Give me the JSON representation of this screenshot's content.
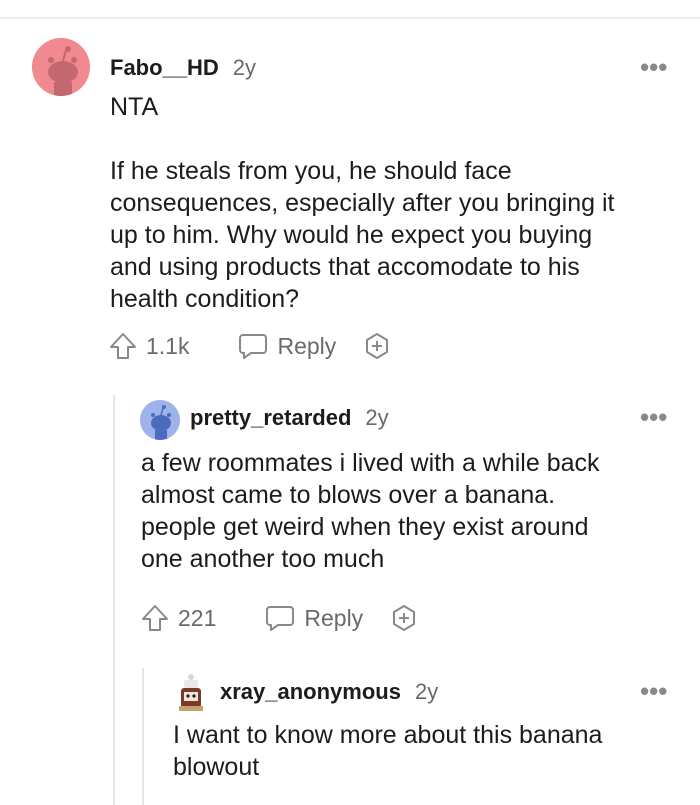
{
  "comments": [
    {
      "author": "Fabo__HD",
      "age": "2y",
      "more_label": "•••",
      "body": "NTA\n\nIf he steals from you, he should face\nconsequences, especially after you bringing it\nup to him. Why would he expect you buying\nand using products that accomodate to his\nhealth condition?",
      "upvotes": "1.1k",
      "reply_label": "Reply",
      "avatar_color": "#f08a90",
      "icons": [
        "upvote-icon",
        "reply-icon",
        "award-icon"
      ]
    },
    {
      "author": "pretty_retarded",
      "age": "2y",
      "more_label": "•••",
      "body": "a few roommates i lived with a while back\nalmost came to blows over a banana.\npeople get weird when they exist around\none another too much",
      "upvotes": "221",
      "reply_label": "Reply",
      "avatar_color": "#9db3ea",
      "icons": [
        "upvote-icon",
        "reply-icon",
        "award-icon"
      ]
    },
    {
      "author": "xray_anonymous",
      "age": "2y",
      "more_label": "•••",
      "body": "I want to know more about this banana\nblowout",
      "avatar_color": "#7a3a2a"
    }
  ]
}
